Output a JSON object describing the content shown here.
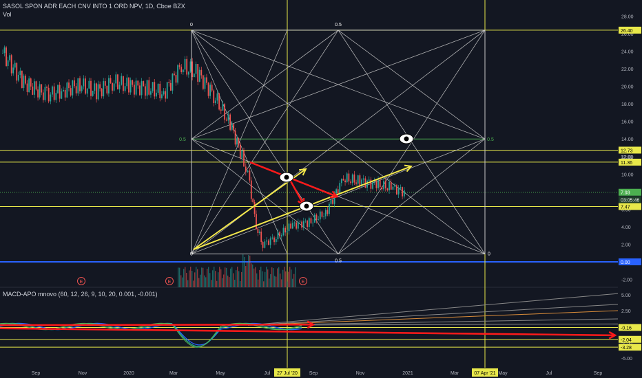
{
  "chart_title": "SASOL SPON ADR EACH CNV INTO 1 ORD NPV, 1D, Cboe BZX",
  "volume_label": "Vol",
  "macd_title": "MACD-APO mnovo (60, 12, 26, 9, 10, 20, 0.001, -0.001)",
  "colors": {
    "background": "#131722",
    "up_candle": "#26a69a",
    "down_candle": "#ef5350",
    "gann_lines": "#c8c8c8",
    "hline": "#e8e84a",
    "blue_line": "#2962ff",
    "green_line": "#4caf50",
    "red_arrow": "#ff1a1a",
    "yellow_arrow": "#f5e94b"
  },
  "icons": [
    "eye-icon",
    "earnings-icon"
  ],
  "chart_data": [
    {
      "type": "candlestick",
      "title": "SASOL SPON ADR EACH CNV INTO 1 ORD NPV, 1D, Cboe BZX",
      "y_ticks": [
        "28.00",
        "26.00",
        "24.00",
        "22.00",
        "20.00",
        "18.00",
        "16.00",
        "14.00",
        "12.00",
        "10.00",
        "8.00",
        "6.00",
        "4.00",
        "2.00",
        "0.00",
        "-2.00"
      ],
      "x_ticks": [
        "Sep",
        "Nov",
        "2020",
        "Mar",
        "May",
        "Jul",
        "Sep",
        "Nov",
        "2021",
        "Mar",
        "May",
        "Jul",
        "Sep"
      ],
      "ylim": [
        -2.5,
        29.5
      ],
      "x": [
        "2019-08-01",
        "2019-08-20",
        "2019-09-10",
        "2019-09-25",
        "2019-10-10",
        "2019-10-25",
        "2019-11-10",
        "2019-11-25",
        "2019-12-10",
        "2019-12-25",
        "2020-01-10",
        "2020-01-25",
        "2020-02-10",
        "2020-02-25",
        "2020-03-05",
        "2020-03-12",
        "2020-03-18",
        "2020-03-24",
        "2020-04-05",
        "2020-04-20",
        "2020-05-05",
        "2020-05-20",
        "2020-06-05",
        "2020-06-20",
        "2020-07-05",
        "2020-07-20",
        "2020-08-01"
      ],
      "close": [
        23.8,
        20.4,
        19.0,
        19.5,
        20.2,
        19.4,
        20.5,
        20.0,
        19.8,
        19.2,
        22.3,
        21.5,
        18.7,
        15.2,
        12.0,
        9.0,
        4.0,
        2.0,
        2.8,
        4.2,
        4.5,
        5.6,
        9.5,
        9.2,
        8.8,
        8.4,
        7.9
      ],
      "price_labels": [
        {
          "text": "26.40",
          "y": 26.4
        },
        {
          "text": "12.73",
          "y": 12.73
        },
        {
          "text": "12.00",
          "y": 12.0
        },
        {
          "text": "11.36",
          "y": 11.36
        },
        {
          "text": "7.93",
          "y": 7.93
        },
        {
          "text": "03:05:46",
          "y": 7.1
        },
        {
          "text": "7.47",
          "y": 6.3
        },
        {
          "text": "0.00",
          "y": 0.0
        }
      ],
      "annotations": [
        {
          "text": "0",
          "x": "2020-04-01",
          "y": 26.4
        },
        {
          "text": "0.5",
          "x": "2020-08-23",
          "y": 26.4
        },
        {
          "text": "0.5",
          "x": "2020-04-01",
          "y": 14.0
        },
        {
          "text": "0.5",
          "x": "2021-01-18",
          "y": 14.0
        },
        {
          "text": "0",
          "x": "2020-04-01",
          "y": 0.5
        },
        {
          "text": "0.5",
          "x": "2020-08-23",
          "y": -0.6
        },
        {
          "text": "0",
          "x": "2021-01-18",
          "y": 0.5
        }
      ],
      "earnings_markers": [
        "E",
        "E",
        "E"
      ],
      "date_labels": [
        "27 Jul '20",
        "07 Apr '21"
      ]
    },
    {
      "type": "line",
      "title": "MACD-APO mnovo (60, 12, 26, 9, 10, 20, 0.001, -0.001)",
      "y_ticks": [
        "5.00",
        "2.50",
        "0.00",
        "-2.50",
        "-5.00"
      ],
      "ylim": [
        -6,
        6.2
      ],
      "price_labels": [
        {
          "text": "-0.16",
          "y": -0.16
        },
        {
          "text": "-2.04",
          "y": -2.04
        },
        {
          "text": "-3.28",
          "y": -3.28
        }
      ]
    }
  ]
}
